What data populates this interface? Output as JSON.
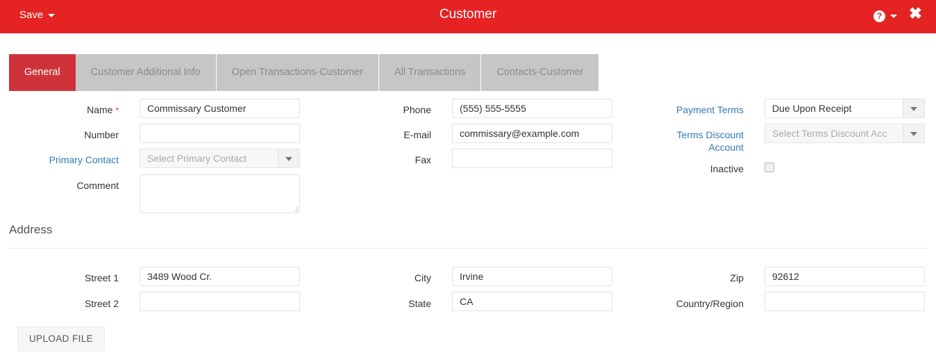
{
  "titlebar": {
    "save_label": "Save",
    "title": "Customer",
    "help_glyph": "?",
    "close_glyph": "✖",
    "brand_color": "#e52322"
  },
  "tabs": [
    {
      "label": "General",
      "active": true
    },
    {
      "label": "Customer Additional Info",
      "active": false
    },
    {
      "label": "Open Transactions-Customer",
      "active": false
    },
    {
      "label": "All Transactions",
      "active": false
    },
    {
      "label": "Contacts-Customer",
      "active": false
    }
  ],
  "general": {
    "name": {
      "label": "Name",
      "required_mark": "*",
      "value": "Commissary Customer"
    },
    "number": {
      "label": "Number",
      "value": ""
    },
    "primary_contact": {
      "label": "Primary Contact",
      "placeholder": "Select Primary Contact",
      "value": ""
    },
    "comment": {
      "label": "Comment",
      "value": ""
    },
    "phone": {
      "label": "Phone",
      "value": "(555) 555-5555"
    },
    "email": {
      "label": "E-mail",
      "value": "commissary@example.com"
    },
    "fax": {
      "label": "Fax",
      "value": ""
    },
    "payment_terms": {
      "label": "Payment Terms",
      "value": "Due Upon Receipt"
    },
    "terms_discount_account": {
      "label_line1": "Terms Discount",
      "label_line2": "Account",
      "placeholder": "Select Terms Discount Acc",
      "value": ""
    },
    "inactive": {
      "label": "Inactive",
      "checked": false
    }
  },
  "address": {
    "section_label": "Address",
    "street1": {
      "label": "Street 1",
      "value": "3489 Wood Cr."
    },
    "street2": {
      "label": "Street 2",
      "value": ""
    },
    "city": {
      "label": "City",
      "value": "Irvine"
    },
    "state": {
      "label": "State",
      "value": "CA"
    },
    "zip": {
      "label": "Zip",
      "value": "92612"
    },
    "country_region": {
      "label": "Country/Region",
      "value": ""
    }
  },
  "footer": {
    "upload_label": "UPLOAD FILE"
  }
}
